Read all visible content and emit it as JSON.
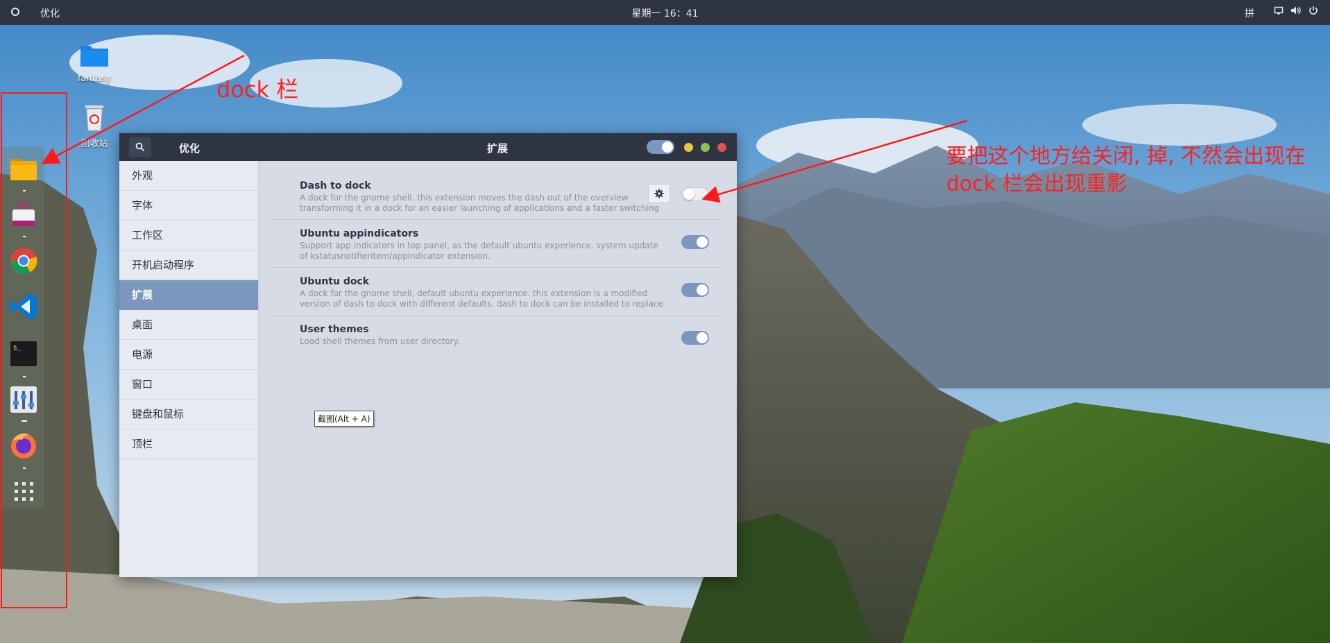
{
  "topbar": {
    "app_menu": "优化",
    "clock": "星期一 16：41",
    "input_method": "拼"
  },
  "desktop": {
    "icons": [
      {
        "label": "fantasy"
      },
      {
        "label": "回收站"
      }
    ]
  },
  "annotations": {
    "dock_label": "dock 栏",
    "note_line1": "要把这个地方给关闭, 掉, 不然会出现在",
    "note_line2": "dock 栏会出现重影",
    "color": "#ff1a1a"
  },
  "window": {
    "app_title": "优化",
    "section_title": "扩展",
    "sidebar": {
      "items": [
        "外观",
        "字体",
        "工作区",
        "开机启动程序",
        "扩展",
        "桌面",
        "电源",
        "窗口",
        "键盘和鼠标",
        "顶栏"
      ],
      "active": "扩展"
    },
    "extensions": [
      {
        "name": "Dash to dock",
        "description": "A dock for the gnome shell. this extension moves the dash out of the overview transforming it in a dock for an easier launching of applications and a faster switching …",
        "has_settings": true,
        "enabled": false
      },
      {
        "name": "Ubuntu appindicators",
        "description": "Support app indicators in top panel, as the default ubuntu experience. system update of kstatusnotifieritem/appindicator extension.",
        "has_settings": false,
        "enabled": true
      },
      {
        "name": "Ubuntu dock",
        "description": "A dock for the gnome shell, default ubuntu experience. this extension is a modified version of dash to dock with different defaults. dash to dock can be installed to replace it and give more …",
        "has_settings": false,
        "enabled": true
      },
      {
        "name": "User themes",
        "description": "Load shell themes from user directory.",
        "has_settings": false,
        "enabled": true
      }
    ],
    "tooltip": "截图(Alt + A)"
  },
  "colors": {
    "accent": "#7b97bd",
    "titlebar": "#2f3443",
    "minimize": "#e8c547",
    "maximize": "#8fbf5a",
    "close": "#e0505a"
  },
  "icons": [
    "search-icon",
    "gear-icon",
    "screen-icon",
    "volume-icon",
    "power-icon"
  ]
}
